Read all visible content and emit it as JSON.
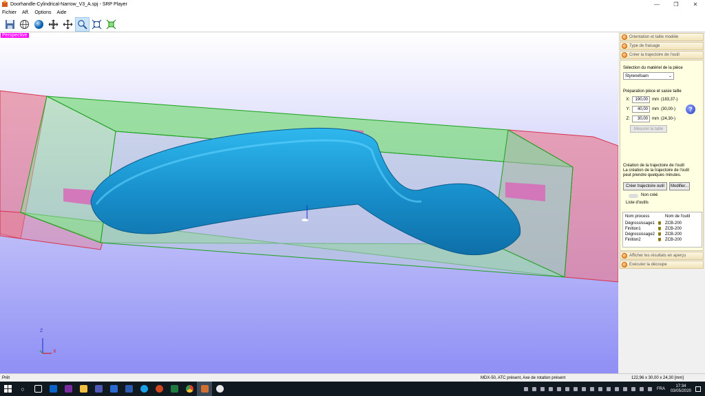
{
  "window": {
    "title": "Doorhandle-Cylindrical-Narrow_V3_A.spj - SRP Player",
    "minimize": "—",
    "maximize": "❐",
    "close": "✕"
  },
  "menu": [
    "Fichier",
    "Aff.",
    "Options",
    "Aide"
  ],
  "toolbar": {
    "tools": [
      "save-icon",
      "globe-wire-icon",
      "sphere-icon",
      "rotate-icon",
      "pan-icon",
      "zoom-icon",
      "fit-icon",
      "fit-selection-icon"
    ],
    "active": "zoom-icon"
  },
  "viewport": {
    "label": "Perspective",
    "axis_z": "Z",
    "axis_x": "X"
  },
  "panel": {
    "headers": {
      "orientation": "Orientation et taille modèle",
      "milling": "Type de fraisage",
      "toolpath": "Créer la trajectoire de l'outil",
      "preview": "Afficher les résultats en aperçu",
      "cut": "Exécuter la découpe"
    },
    "material_label": "Sélection du matériel de la pièce",
    "material_value": "Styrenefoam",
    "size_label": "Préparation pièce et saisie taille",
    "size": {
      "x": {
        "axis": "X:",
        "value": "190,00",
        "unit": "mm",
        "range": "(183,37-)"
      },
      "y": {
        "axis": "Y:",
        "value": "40,00",
        "unit": "mm",
        "range": "(30,00-)"
      },
      "z": {
        "axis": "Z:",
        "value": "30,00",
        "unit": "mm",
        "range": "(24,30-)"
      }
    },
    "help": "?",
    "measure_button": "Mesurer la taille",
    "tp_title": "Création de la trajectoire de l'outil",
    "tp_desc1": "La création de la trajectoire de l'outil",
    "tp_desc2": "peut prendre quelques minutes.",
    "create_button": "Créer trajectoire outil",
    "modify_button": "Modifier...",
    "status": "Non créé",
    "tool_list_label": "Liste d'outils",
    "tool_list": {
      "headers": [
        "Nom process",
        "Nom de l'outil"
      ],
      "rows": [
        {
          "process": "Dégrossissage1",
          "tool": "ZCB-200"
        },
        {
          "process": "Finition1",
          "tool": "ZCB-200"
        },
        {
          "process": "Dégrossissage2",
          "tool": "ZCB-200"
        },
        {
          "process": "Finition2",
          "tool": "ZCB-200"
        }
      ]
    }
  },
  "statusbar": {
    "left": "Prêt",
    "middle": "MDX-50, ATC présent, Axe de rotation présent",
    "right": "122,96 x 30,00 x 24,30 [mm]"
  },
  "taskbar": {
    "lang": "FRA",
    "time": "17:34",
    "date": "03/05/2020"
  },
  "colors": {
    "model": "#1aa3d9",
    "stock_green": "#5fd45f",
    "stock_red": "#e04a6a",
    "viewport_bottom": "#8f8ff5"
  }
}
